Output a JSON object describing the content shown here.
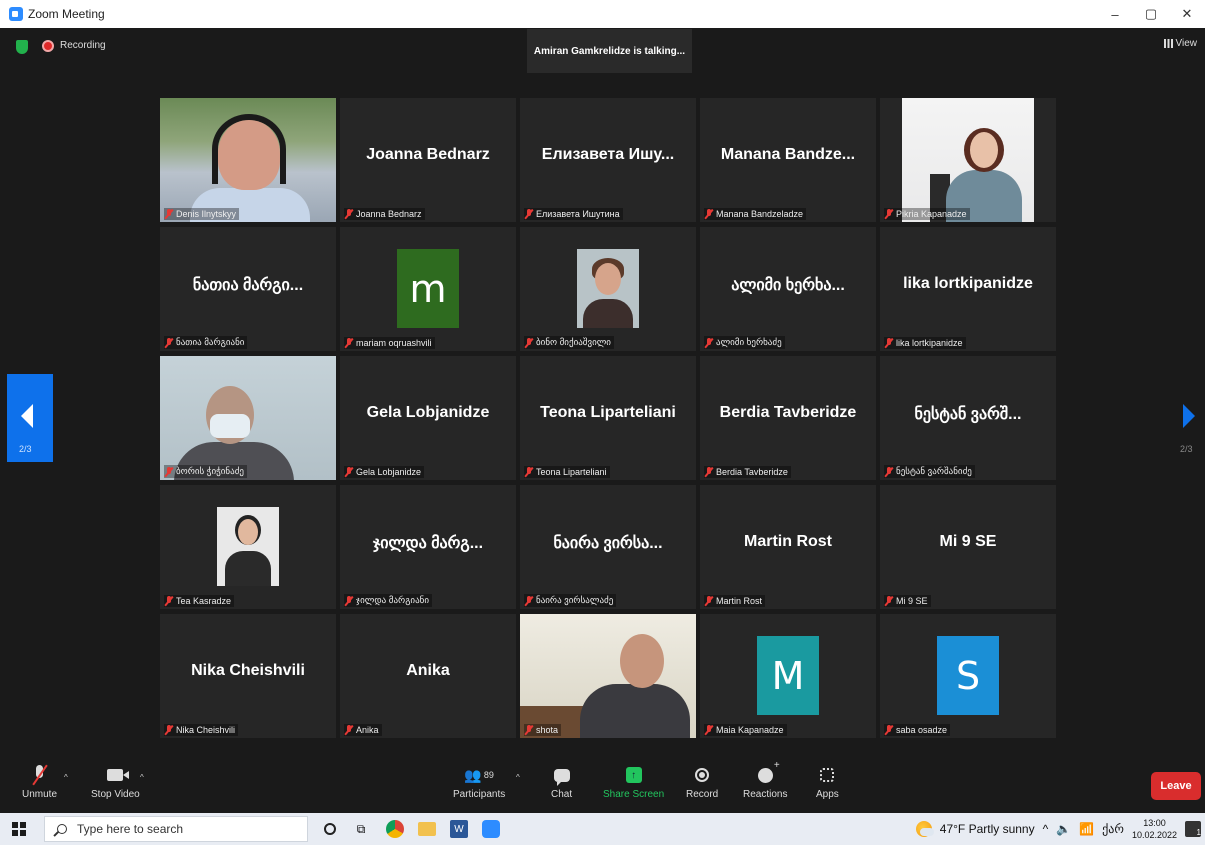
{
  "window": {
    "title": "Zoom Meeting",
    "controls": [
      "–",
      "▢",
      "✕"
    ]
  },
  "topbar": {
    "recording_label": "Recording",
    "talking": "Amiran Gamkrelidze is talking...",
    "view_label": "View"
  },
  "paging": {
    "left": "2/3",
    "right": "2/3"
  },
  "tiles": [
    {
      "big": "",
      "label": "Denis Ilnytskyy",
      "kind": "video-denis"
    },
    {
      "big": "Joanna Bednarz",
      "label": "Joanna Bednarz",
      "kind": "name"
    },
    {
      "big": "Елизавета  Ишу...",
      "label": "Елизавета Ишутина",
      "kind": "name"
    },
    {
      "big": "Manana  Bandze...",
      "label": "Manana Bandzeladze",
      "kind": "name"
    },
    {
      "big": "",
      "label": "Pikria Kapanadze",
      "kind": "video-pikria"
    },
    {
      "big": "ნათია მარგი...",
      "label": "ნათია მარგიანი",
      "kind": "name"
    },
    {
      "big": "m",
      "label": "mariam oqruashvili",
      "kind": "letter",
      "color": "#2e6b1f"
    },
    {
      "big": "",
      "label": "ბინო მიქიაშვილი",
      "kind": "photo-bino"
    },
    {
      "big": "ალიმი ხერხა...",
      "label": "ალიმი ხერხაძე",
      "kind": "name"
    },
    {
      "big": "lika lortkipanidze",
      "label": "lika lortkipanidze",
      "kind": "name"
    },
    {
      "big": "",
      "label": "ბორის ჭიჭინაძე",
      "kind": "video-boris"
    },
    {
      "big": "Gela Lobjanidze",
      "label": "Gela Lobjanidze",
      "kind": "name"
    },
    {
      "big": "Teona Liparteliani",
      "label": "Teona Liparteliani",
      "kind": "name"
    },
    {
      "big": "Berdia Tavberidze",
      "label": "Berdia Tavberidze",
      "kind": "name"
    },
    {
      "big": "ნესტან ვარშ...",
      "label": "ნესტან ვარშანიძე",
      "kind": "name"
    },
    {
      "big": "",
      "label": "Tea Kasradze",
      "kind": "photo-tea"
    },
    {
      "big": "ჯილდა მარგ...",
      "label": "ჯილდა მარგიანი",
      "kind": "name"
    },
    {
      "big": "ნაირა ვირსა...",
      "label": "ნაირა ვირსალაძე",
      "kind": "name"
    },
    {
      "big": "Martin Rost",
      "label": "Martin Rost",
      "kind": "name"
    },
    {
      "big": "Mi 9 SE",
      "label": "Mi 9 SE",
      "kind": "name"
    },
    {
      "big": "Nika Cheishvili",
      "label": "Nika Cheishvili",
      "kind": "name"
    },
    {
      "big": "Anika",
      "label": "Anika",
      "kind": "name"
    },
    {
      "big": "",
      "label": "shota",
      "kind": "video-shota"
    },
    {
      "big": "M",
      "label": "Maia Kapanadze",
      "kind": "letter",
      "color": "#1a9aa0"
    },
    {
      "big": "S",
      "label": "saba osadze",
      "kind": "letter",
      "color": "#1b8fd6"
    }
  ],
  "toolbar": {
    "unmute": "Unmute",
    "stop_video": "Stop Video",
    "participants": "Participants",
    "participants_count": "89",
    "chat": "Chat",
    "share_screen": "Share Screen",
    "record": "Record",
    "reactions": "Reactions",
    "apps": "Apps",
    "leave": "Leave"
  },
  "taskbar": {
    "search_placeholder": "Type here to search",
    "weather": "47°F  Partly sunny",
    "lang": "ქარ",
    "time": "13:00",
    "date": "10.02.2022",
    "notif_count": "1"
  },
  "colors": {
    "accent": "#0e71eb",
    "leave": "#d92d2d",
    "share": "#22c55e"
  }
}
